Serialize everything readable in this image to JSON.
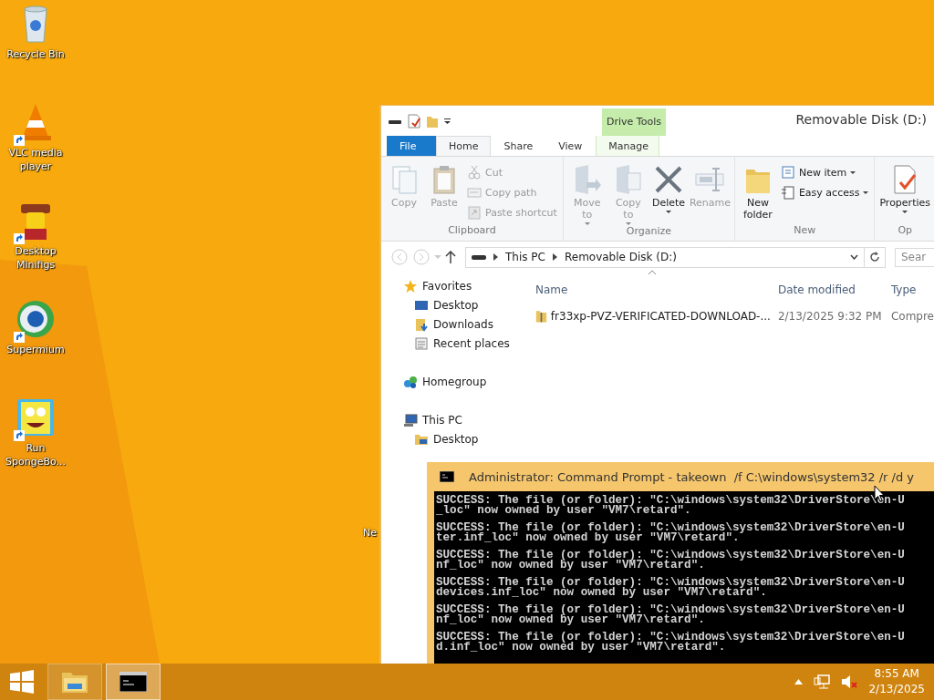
{
  "desktop_icons": [
    {
      "label": "Recycle Bin",
      "kind": "recycle-bin",
      "shortcut": false
    },
    {
      "label": "VLC media player",
      "kind": "cone",
      "shortcut": true
    },
    {
      "label": "Desktop Minifigs",
      "kind": "minifig",
      "shortcut": true
    },
    {
      "label": "Supermium",
      "kind": "globe",
      "shortcut": true
    },
    {
      "label": "Run SpongeBo...",
      "kind": "sponge",
      "shortcut": true
    }
  ],
  "partial_icon": {
    "label": "Ne"
  },
  "explorer": {
    "title": "Removable Disk (D:)",
    "context_group": "Drive Tools",
    "tabs": [
      {
        "label": "File",
        "kind": "file",
        "selected": false
      },
      {
        "label": "Home",
        "kind": "tab",
        "selected": true
      },
      {
        "label": "Share",
        "kind": "tab",
        "selected": false
      },
      {
        "label": "View",
        "kind": "tab",
        "selected": false
      },
      {
        "label": "Manage",
        "kind": "context",
        "selected": false
      }
    ],
    "ribbon_groups": [
      {
        "label": "Clipboard",
        "commands": [
          {
            "label": "Copy",
            "kind": "copy",
            "disabled": true
          },
          {
            "label": "Paste",
            "kind": "paste",
            "disabled": true
          },
          {
            "kind": "stack",
            "commands": [
              {
                "label": "Cut",
                "kind": "cut",
                "disabled": true
              },
              {
                "label": "Copy path",
                "kind": "copy-path",
                "disabled": true
              },
              {
                "label": "Paste shortcut",
                "kind": "paste-shortcut",
                "disabled": true
              }
            ]
          }
        ]
      },
      {
        "label": "Organize",
        "commands": [
          {
            "label": "Move to",
            "kind": "move-to",
            "disabled": true,
            "dropdown": true
          },
          {
            "label": "Copy to",
            "kind": "copy-to",
            "disabled": true,
            "dropdown": true
          },
          {
            "label": "Delete",
            "kind": "delete",
            "disabled": false,
            "dropdown": true
          },
          {
            "label": "Rename",
            "kind": "rename",
            "disabled": true
          }
        ]
      },
      {
        "label": "New",
        "commands": [
          {
            "label": "New folder",
            "kind": "new-folder",
            "disabled": false
          },
          {
            "kind": "stack",
            "commands": [
              {
                "label": "New item",
                "kind": "new-item",
                "disabled": false,
                "dropdown": true
              },
              {
                "label": "Easy access",
                "kind": "easy-access",
                "disabled": false,
                "dropdown": true
              }
            ]
          }
        ]
      },
      {
        "label": "Op",
        "commands": [
          {
            "label": "Properties",
            "kind": "properties",
            "disabled": false,
            "dropdown": true
          }
        ]
      }
    ],
    "breadcrumbs": [
      "This PC",
      "Removable Disk (D:)"
    ],
    "search": {
      "placeholder": "Sear"
    },
    "navigation": [
      {
        "label": "Favorites",
        "kind": "star",
        "children": [
          {
            "label": "Desktop",
            "kind": "desktop"
          },
          {
            "label": "Downloads",
            "kind": "downloads"
          },
          {
            "label": "Recent places",
            "kind": "recent"
          }
        ]
      },
      {
        "label": "Homegroup",
        "kind": "homegroup"
      },
      {
        "label": "This PC",
        "kind": "pc",
        "children": [
          {
            "label": "Desktop",
            "kind": "folder"
          }
        ]
      }
    ],
    "columns": [
      "Name",
      "Date modified",
      "Type"
    ],
    "rows": [
      {
        "name": "fr33xp-PVZ-VERIFICATED-DOWNLOAD-...",
        "date": "2/13/2025 9:32 PM",
        "type": "Compre"
      }
    ]
  },
  "console": {
    "title": "Administrator: Command Prompt - takeown  /f C:\\windows\\system32 /r /d y",
    "entries": [
      [
        "SUCCESS: The file (or folder): \"C:\\windows\\system32\\DriverStore\\en-U",
        "_loc\" now owned by user \"VM7\\retard\"."
      ],
      [
        "SUCCESS: The file (or folder): \"C:\\windows\\system32\\DriverStore\\en-U",
        "ter.inf_loc\" now owned by user \"VM7\\retard\"."
      ],
      [
        "SUCCESS: The file (or folder): \"C:\\windows\\system32\\DriverStore\\en-U",
        "nf_loc\" now owned by user \"VM7\\retard\"."
      ],
      [
        "SUCCESS: The file (or folder): \"C:\\windows\\system32\\DriverStore\\en-U",
        "devices.inf_loc\" now owned by user \"VM7\\retard\"."
      ],
      [
        "SUCCESS: The file (or folder): \"C:\\windows\\system32\\DriverStore\\en-U",
        "nf_loc\" now owned by user \"VM7\\retard\"."
      ],
      [
        "SUCCESS: The file (or folder): \"C:\\windows\\system32\\DriverStore\\en-U",
        "d.inf_loc\" now owned by user \"VM7\\retard\"."
      ]
    ]
  },
  "taskbar": {
    "apps": [
      {
        "kind": "explorer",
        "active": false
      },
      {
        "kind": "console",
        "active": true
      }
    ],
    "time": "8:55 AM",
    "date": "2/13/2025"
  }
}
